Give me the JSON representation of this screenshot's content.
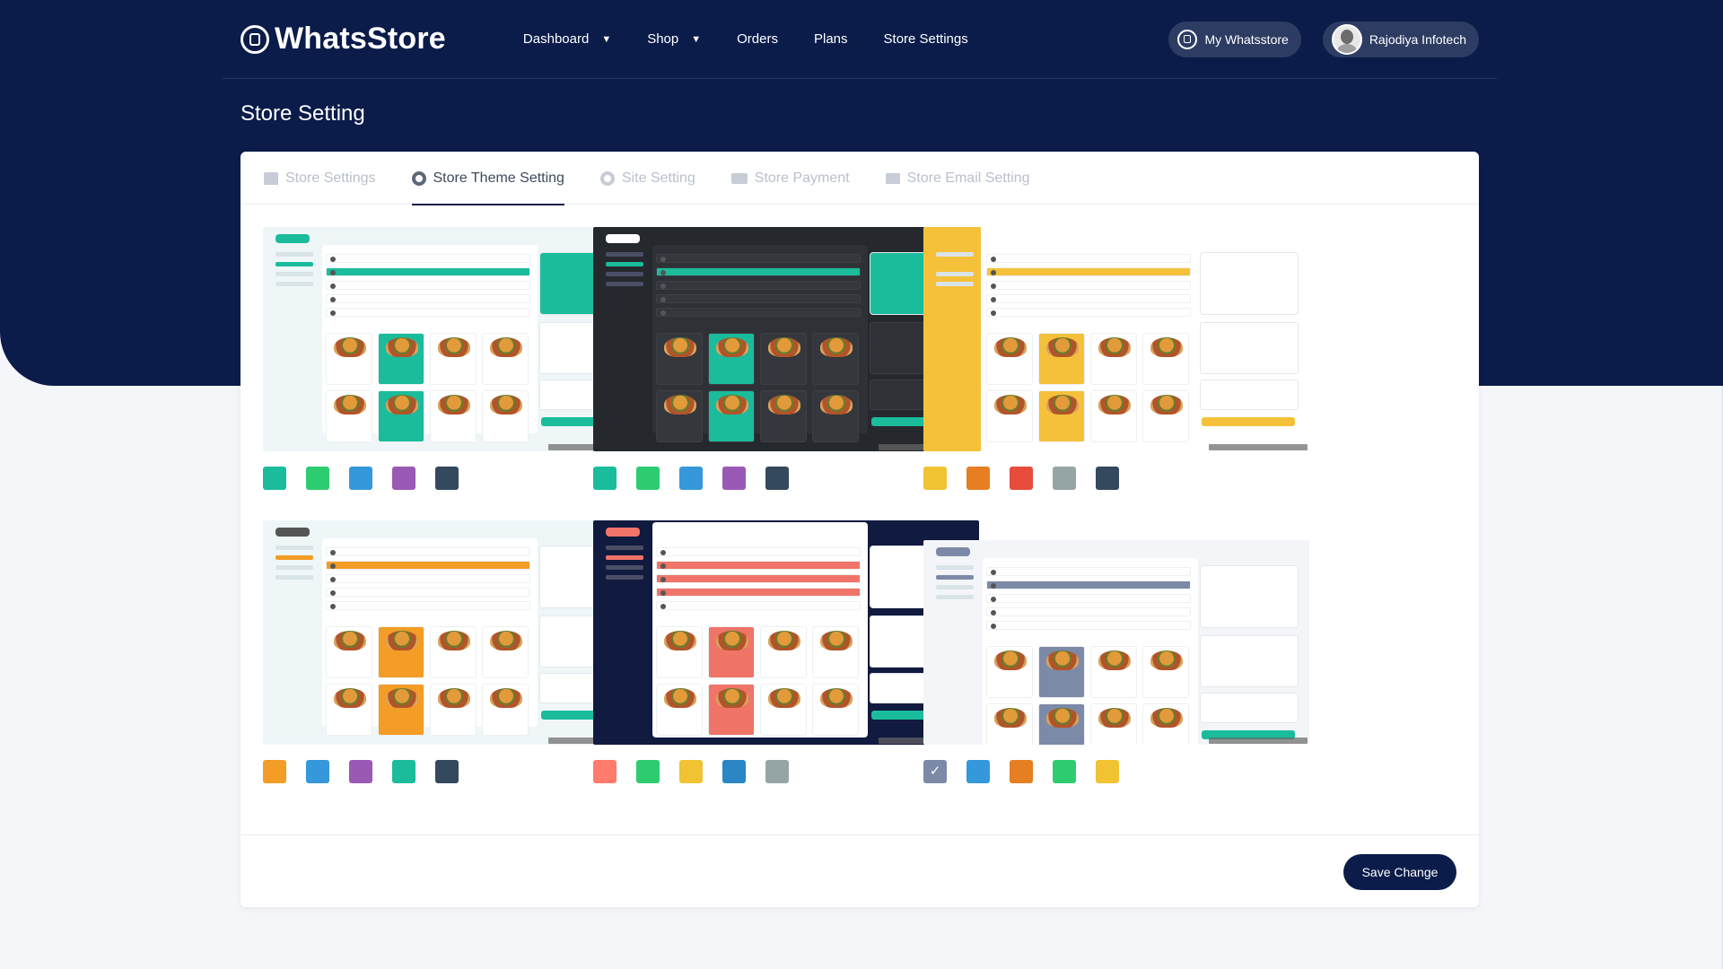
{
  "brand": {
    "name": "WhatsStore"
  },
  "nav": {
    "items": [
      {
        "label": "Dashboard",
        "dropdown": true
      },
      {
        "label": "Shop",
        "dropdown": true
      },
      {
        "label": "Orders",
        "dropdown": false
      },
      {
        "label": "Plans",
        "dropdown": false
      },
      {
        "label": "Store Settings",
        "dropdown": false
      }
    ],
    "my_store_label": "My Whatsstore",
    "user_name": "Rajodiya Infotech"
  },
  "page": {
    "title": "Store Setting"
  },
  "tabs": [
    {
      "label": "Store Settings",
      "icon": "store-icon",
      "active": false
    },
    {
      "label": "Store Theme Setting",
      "icon": "gear-icon",
      "active": true
    },
    {
      "label": "Site Setting",
      "icon": "gear-icon",
      "active": false
    },
    {
      "label": "Store Payment",
      "icon": "visa-card-icon",
      "active": false
    },
    {
      "label": "Store Email Setting",
      "icon": "mail-icon",
      "active": false
    }
  ],
  "themes": [
    {
      "name": "theme-1",
      "swatches": [
        "#1abc9c",
        "#2ecc71",
        "#3498db",
        "#9b59b6",
        "#34495e"
      ],
      "selected_swatch": null
    },
    {
      "name": "theme-2",
      "swatches": [
        "#1abc9c",
        "#2ecc71",
        "#3498db",
        "#9b59b6",
        "#34495e"
      ],
      "selected_swatch": null
    },
    {
      "name": "theme-3",
      "swatches": [
        "#f1c232",
        "#e67e22",
        "#e74c3c",
        "#95a5a6",
        "#34495e"
      ],
      "selected_swatch": null
    },
    {
      "name": "theme-4",
      "swatches": [
        "#f39c26",
        "#3498db",
        "#9b59b6",
        "#1abc9c",
        "#34495e"
      ],
      "selected_swatch": null
    },
    {
      "name": "theme-5",
      "swatches": [
        "#ff7b6b",
        "#2ecc71",
        "#f1c232",
        "#2a86c4",
        "#95a5a6"
      ],
      "selected_swatch": null
    },
    {
      "name": "theme-6",
      "swatches": [
        "#7c8aa8",
        "#3498db",
        "#e67e22",
        "#2ecc71",
        "#f1c232"
      ],
      "selected_swatch": 0
    }
  ],
  "actions": {
    "save_label": "Save Change"
  },
  "colors": {
    "brand_navy": "#0b1c4a"
  }
}
